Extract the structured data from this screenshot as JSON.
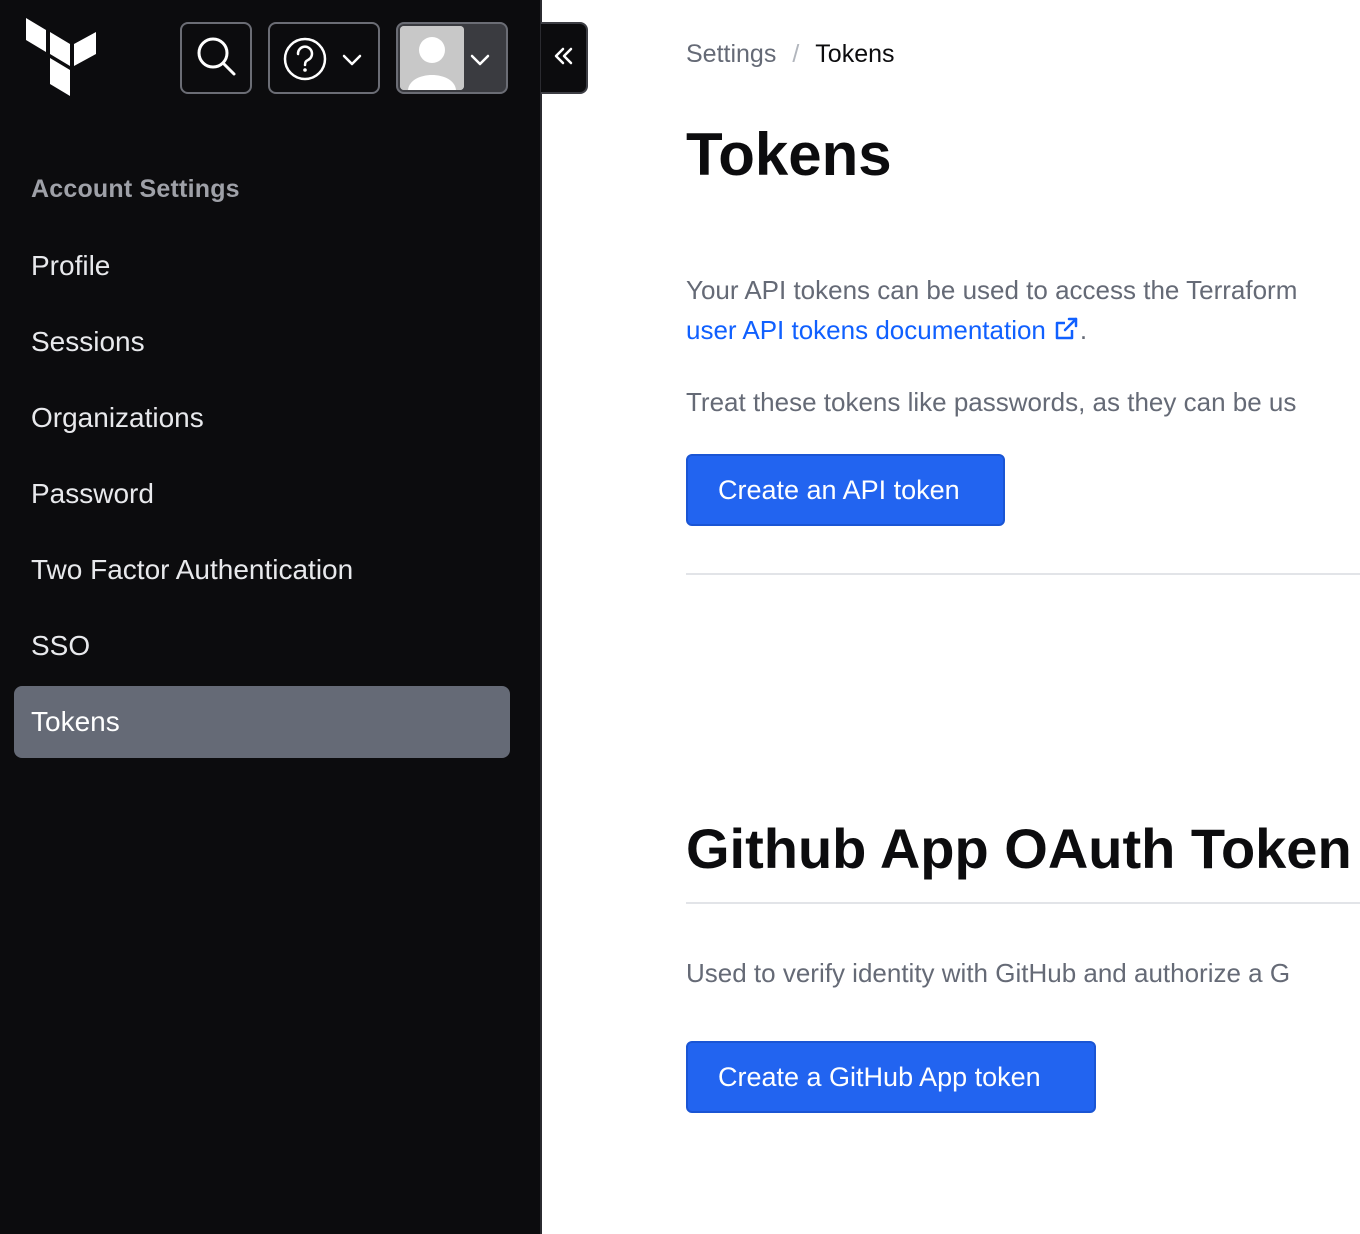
{
  "sidebar": {
    "section_heading": "Account Settings",
    "items": [
      {
        "label": "Profile",
        "active": false
      },
      {
        "label": "Sessions",
        "active": false
      },
      {
        "label": "Organizations",
        "active": false
      },
      {
        "label": "Password",
        "active": false
      },
      {
        "label": "Two Factor Authentication",
        "active": false
      },
      {
        "label": "SSO",
        "active": false
      },
      {
        "label": "Tokens",
        "active": true
      }
    ]
  },
  "header": {
    "icons": [
      "terraform-logo",
      "search-icon",
      "help-icon",
      "chevron-down-icon",
      "user-avatar",
      "chevron-down-icon",
      "collapse-sidebar-icon"
    ]
  },
  "breadcrumb": {
    "parent": "Settings",
    "separator": "/",
    "current": "Tokens"
  },
  "main": {
    "title": "Tokens",
    "intro_text": "Your API tokens can be used to access the Terraform",
    "doc_link": "user API tokens documentation",
    "doc_link_suffix": ".",
    "warning_text": "Treat these tokens like passwords, as they can be us",
    "create_api_button": "Create an API token",
    "github_title": "Github App OAuth Token",
    "github_text": "Used to verify identity with GitHub and authorize a G",
    "create_github_button": "Create a GitHub App token"
  },
  "colors": {
    "sidebar_bg": "#0c0c0e",
    "active_item_bg": "#656a76",
    "primary_button": "#2264f0",
    "link": "#1060ff"
  }
}
